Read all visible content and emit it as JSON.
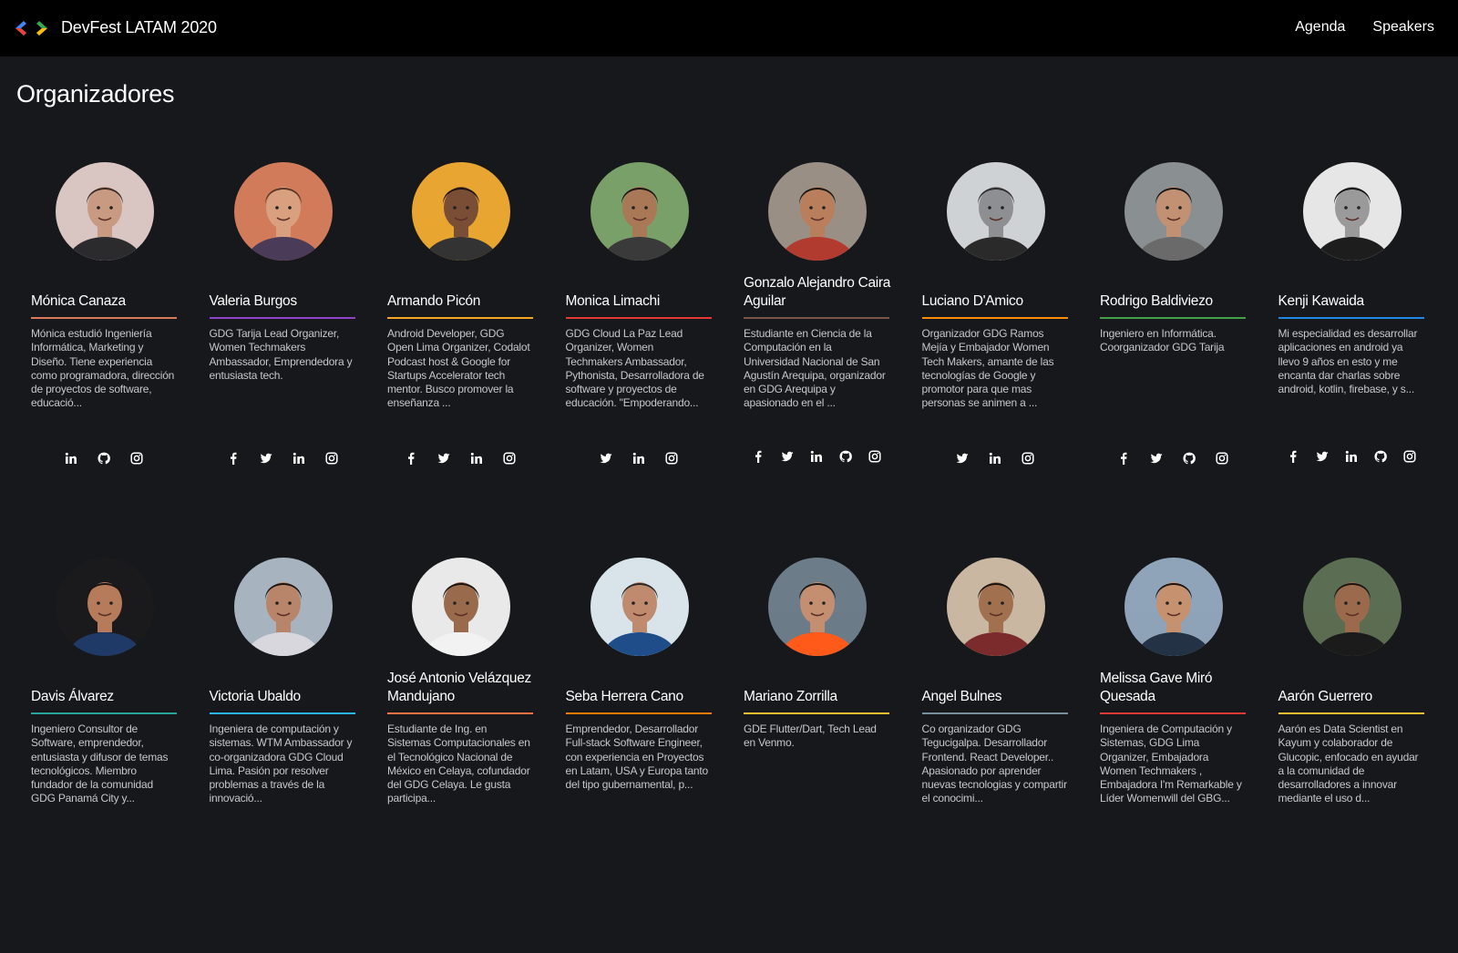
{
  "app": {
    "brand": "DevFest LATAM 2020",
    "logo_colors": [
      "#4285f4",
      "#ea4335",
      "#34a853",
      "#fbbc04"
    ]
  },
  "nav": {
    "agenda": "Agenda",
    "speakers": "Speakers"
  },
  "page": {
    "title": "Organizadores"
  },
  "organizers": [
    {
      "name": "Mónica Canaza",
      "accent": "#d97a5a",
      "bio": "Mónica estudió Ingeniería Informática, Marketing y Diseño. Tiene experiencia como programadora, dirección de proyectos de software, educació...",
      "socials": [
        "linkedin",
        "github",
        "instagram"
      ],
      "avatar_bg": "#d9c6c2",
      "avatar_skin": "#c99a82"
    },
    {
      "name": "Valeria Burgos",
      "accent": "#8e44c9",
      "bio": "GDG Tarija Lead Organizer, Women Techmakers Ambassador, Emprendedora y entusiasta tech.",
      "socials": [
        "facebook",
        "twitter",
        "linkedin",
        "instagram"
      ],
      "avatar_bg": "#d27b5a",
      "avatar_skin": "#d9a07f"
    },
    {
      "name": "Armando Picón",
      "accent": "#f5a623",
      "bio": "Android Developer, GDG Open Lima Organizer, Codalot Podcast host & Google for Startups Accelerator tech mentor. Busco promover la enseñanza ...",
      "socials": [
        "facebook",
        "twitter",
        "linkedin",
        "instagram"
      ],
      "avatar_bg": "#e8a531",
      "avatar_skin": "#7a4e35"
    },
    {
      "name": "Monica Limachi",
      "accent": "#e53935",
      "bio": "GDG Cloud La Paz  Lead Organizer, Women Techmakers Ambassador, Pythonista, Desarrolladora de software y proyectos de educación. \"Empoderando...",
      "socials": [
        "twitter",
        "linkedin",
        "instagram"
      ],
      "avatar_bg": "#7aa06a",
      "avatar_skin": "#a97856"
    },
    {
      "name": "Gonzalo Alejandro Caira Aguilar",
      "accent": "#795548",
      "bio": "Estudiante en Ciencia de la Computación en la Universidad Nacional de San Agustín Arequipa, organizador en GDG Arequipa  y apasionado en el ...",
      "socials": [
        "facebook",
        "twitter",
        "linkedin",
        "github",
        "instagram"
      ],
      "avatar_bg": "#9a8f85",
      "avatar_skin": "#b97f5d"
    },
    {
      "name": "Luciano D'Amico",
      "accent": "#fb8c00",
      "bio": "Organizador GDG Ramos Mejía y Embajador Women Tech Makers, amante de las tecnologías de Google y promotor para que mas personas se animen a ...",
      "socials": [
        "twitter",
        "linkedin",
        "instagram"
      ],
      "avatar_bg": "#cfd2d4",
      "avatar_skin": "#8d8f92"
    },
    {
      "name": "Rodrigo Baldiviezo",
      "accent": "#43a047",
      "bio": "Ingeniero en Informática. Coorganizador GDG Tarija",
      "socials": [
        "facebook",
        "twitter",
        "github",
        "instagram"
      ],
      "avatar_bg": "#8a8f92",
      "avatar_skin": "#c29173"
    },
    {
      "name": "Kenji Kawaida",
      "accent": "#1e88e5",
      "bio": "Mi especialidad es desarrollar aplicaciones en android ya llevo 9 años en esto y me encanta dar charlas sobre android, kotlin, firebase, y s...",
      "socials": [
        "facebook",
        "twitter",
        "linkedin",
        "github",
        "instagram"
      ],
      "avatar_bg": "#e6e6e6",
      "avatar_skin": "#9a9a9a"
    },
    {
      "name": "Davis Álvarez",
      "accent": "#26a69a",
      "bio": "Ingeniero Consultor de Software, emprendedor, entusiasta y difusor de temas tecnológicos. Miembro fundador de la comunidad GDG Panamá City y...",
      "socials": [],
      "avatar_bg": "#1a1a1d",
      "avatar_skin": "#b57b5a"
    },
    {
      "name": "Victoria Ubaldo",
      "accent": "#29b6f6",
      "bio": "Ingeniera de computación y sistemas. WTM Ambassador y co-organizadora GDG Cloud Lima. Pasión por resolver problemas a través de la innovació...",
      "socials": [],
      "avatar_bg": "#a7b4c0",
      "avatar_skin": "#b9856a"
    },
    {
      "name": "José Antonio Velázquez Mandujano",
      "accent": "#ff7043",
      "bio": "Estudiante de Ing. en Sistemas Computacionales en el Tecnológico Nacional de México en Celaya, cofundador del GDG Celaya. Le gusta participa...",
      "socials": [],
      "avatar_bg": "#e9e9e9",
      "avatar_skin": "#9a6a4c"
    },
    {
      "name": "Seba Herrera Cano",
      "accent": "#f57c00",
      "bio": "Emprendedor, Desarrollador Full-stack Software Engineer, con experiencia en Proyectos en Latam, USA y Europa tanto del tipo gubernamental, p...",
      "socials": [],
      "avatar_bg": "#d8e4ea",
      "avatar_skin": "#c08a6e"
    },
    {
      "name": "Mariano Zorrilla",
      "accent": "#fbc02d",
      "bio": "GDE Flutter/Dart, Tech Lead en Venmo.",
      "socials": [],
      "avatar_bg": "#6c7c88",
      "avatar_skin": "#c48e70"
    },
    {
      "name": "Angel Bulnes",
      "accent": "#78909c",
      "bio": "Co organizador GDG Tegucigalpa. Desarrollador Frontend. React Developer.. Apasionado por aprender nuevas tecnologias y compartir el conocimi...",
      "socials": [],
      "avatar_bg": "#c9b7a2",
      "avatar_skin": "#a0704f"
    },
    {
      "name": "Melissa Gave Miró Quesada",
      "accent": "#e53935",
      "bio": "Ingeniera de Computación y Sistemas, GDG Lima Organizer,  Embajadora Women Techmakers , Embajadora I'm Remarkable y Líder Womenwill del GBG...",
      "socials": [],
      "avatar_bg": "#8fa4b8",
      "avatar_skin": "#c6916f"
    },
    {
      "name": "Aarón Guerrero",
      "accent": "#fbc02d",
      "bio": "Aarón es Data Scientist en Kayum y colaborador de Glucopic, enfocado en ayudar a la comunidad de desarrolladores a innovar mediante el uso d...",
      "socials": [],
      "avatar_bg": "#5b6d52",
      "avatar_skin": "#9b6a4c"
    }
  ]
}
